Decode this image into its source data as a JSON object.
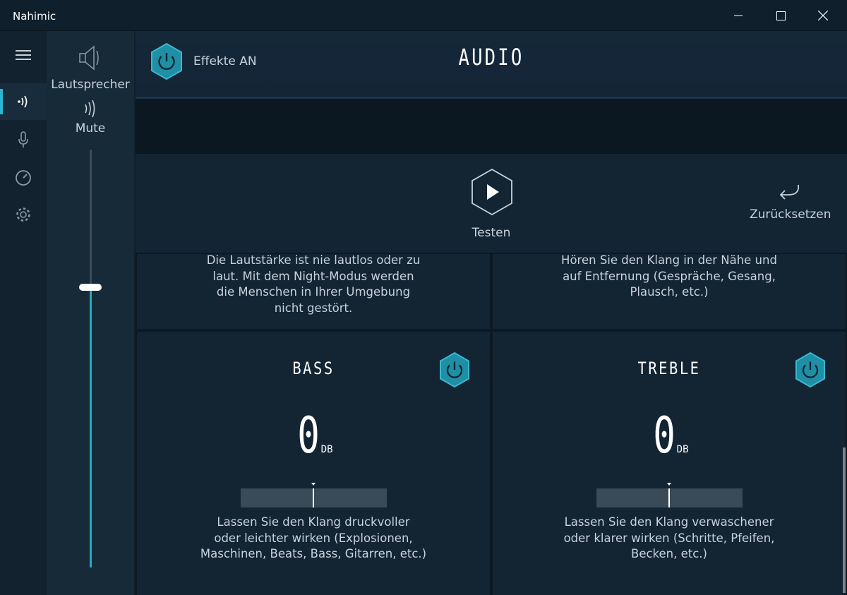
{
  "window": {
    "title": "Nahimic",
    "minimize_icon": "minimize-icon",
    "maximize_icon": "maximize-icon",
    "close_icon": "close-icon"
  },
  "nav": {
    "items": [
      {
        "icon": "menu-icon"
      },
      {
        "icon": "speaker-wave-icon",
        "active": true
      },
      {
        "icon": "microphone-icon"
      },
      {
        "icon": "gauge-icon"
      },
      {
        "icon": "gear-icon"
      }
    ]
  },
  "volume": {
    "device_label": "Lautsprecher",
    "mute_label": "Mute",
    "level_percent": 67
  },
  "header": {
    "effects_label": "Effekte AN",
    "page_title": "AUDIO"
  },
  "test": {
    "test_label": "Testen",
    "reset_label": "Zurücksetzen"
  },
  "panels": {
    "night_mode_desc": [
      "Die Lautstärke ist nie lautlos oder zu",
      "laut. Mit dem Night-Modus werden",
      "die Menschen in Ihrer Umgebung",
      "nicht gestört."
    ],
    "voice_desc": [
      "Hören Sie den Klang in der Nähe und",
      "auf Entfernung (Gespräche, Gesang,",
      "Plausch, etc.)"
    ],
    "bass": {
      "title": "BASS",
      "value": "0",
      "unit": "DB",
      "desc": [
        "Lassen Sie den Klang druckvoller",
        "oder leichter wirken (Explosionen,",
        "Maschinen, Beats, Bass, Gitarren, etc.)"
      ]
    },
    "treble": {
      "title": "TREBLE",
      "value": "0",
      "unit": "DB",
      "desc": [
        "Lassen Sie den Klang verwaschener",
        "oder klarer wirken (Schritte, Pfeifen,",
        "Becken, etc.)"
      ]
    }
  },
  "colors": {
    "accent": "#2ab7d0",
    "hex_button": "#1f8fa6"
  }
}
